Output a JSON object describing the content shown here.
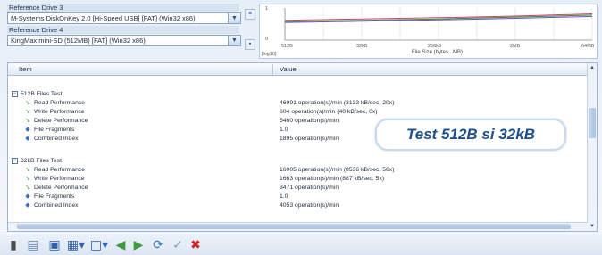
{
  "reference": {
    "drive3_label": "Reference Drive 3",
    "drive3_value": "M-Systems DiskOnKey 2.0 [Hi-Speed USB] [FAT] (Win32 x86)",
    "drive4_label": "Reference Drive 4",
    "drive4_value": "KingMax mini-SD (512MB) [FAT] (Win32 x86)"
  },
  "chart": {
    "y_axis_label": "[log10]",
    "y_ticks": [
      "1",
      "0"
    ],
    "x_ticks": [
      "512B",
      "32kB",
      "256kB",
      "2MB",
      "64MB"
    ],
    "x_label": "File Size (bytes...MB)"
  },
  "chart_data": {
    "type": "line",
    "xlabel": "File Size (bytes...MB)",
    "ylabel": "[log10]",
    "categories": [
      "512B",
      "32kB",
      "256kB",
      "2MB",
      "64MB"
    ],
    "series": [
      {
        "color": "#d0406a",
        "values": [
          0.62,
          0.66,
          0.7,
          0.75,
          0.82
        ]
      },
      {
        "color": "#3a8a3a",
        "values": [
          0.58,
          0.62,
          0.66,
          0.72,
          0.78
        ]
      },
      {
        "color": "#6a55b8",
        "values": [
          0.55,
          0.59,
          0.63,
          0.68,
          0.74
        ]
      }
    ]
  },
  "table": {
    "col_item": "Item",
    "col_value": "Value",
    "groups": [
      {
        "title": "512B Files Test",
        "rows": [
          {
            "label": "Read Performance",
            "value": "46991 operation(s)/min (3133 kB/sec, 20x)"
          },
          {
            "label": "Write Performance",
            "value": "604 operation(s)/min (40 kB/sec, 0x)"
          },
          {
            "label": "Delete Performance",
            "value": "5460 operation(s)/min"
          },
          {
            "label": "File Fragments",
            "value": "1.0"
          },
          {
            "label": "Combined Index",
            "value": "1895 operation(s)/min"
          }
        ]
      },
      {
        "title": "32kB Files Test",
        "rows": [
          {
            "label": "Read Performance",
            "value": "16005 operation(s)/min (8536 kB/sec, 56x)"
          },
          {
            "label": "Write Performance",
            "value": "1663 operation(s)/min (887 kB/sec, 5x)"
          },
          {
            "label": "Delete Performance",
            "value": "3471 operation(s)/min"
          },
          {
            "label": "File Fragments",
            "value": "1.0"
          },
          {
            "label": "Combined Index",
            "value": "4053 operation(s)/min"
          }
        ]
      }
    ]
  },
  "annotation": "Test 512B si 32kB",
  "toolbar_icons": [
    "clipboard-icon",
    "copy-icon",
    "save-icon",
    "report-icon",
    "chart-icon",
    "back-icon",
    "forward-icon",
    "refresh-icon",
    "check-icon",
    "cancel-icon"
  ]
}
